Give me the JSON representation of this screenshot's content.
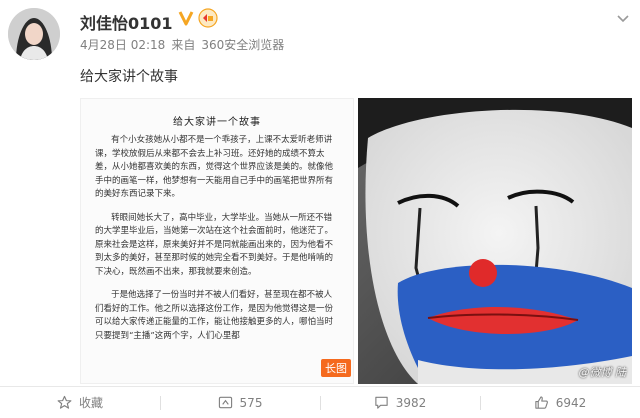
{
  "post": {
    "username": "刘佳怡0101",
    "date": "4月28日 02:18",
    "source_prefix": "来自",
    "source_app": "360安全浏览器",
    "text": "给大家讲个故事"
  },
  "document": {
    "title": "给大家讲一个故事",
    "paragraphs": [
      "有个小女孩她从小都不是一个乖孩子，上课不太爱听老师讲课，学校放假后从来都不会去上补习班。还好她的成绩不算太差，从小她都喜欢美的东西，觉得这个世界应该是美的。就像他手中的画笔一样，他梦想有一天能用自己手中的画笔把世界所有的美好东西记录下来。",
      "转眼间她长大了，高中毕业，大学毕业。当她从一所还不错的大学里毕业后，当她第一次站在这个社会面前时，他迷茫了。原来社会是这样，原来美好并不是同就能画出来的，因为他看不到太多的美好，甚至那时候的她完全看不到美好。于是他啃啃的下决心，既然画不出来，那我就要来创造。",
      "于是他选择了一份当时并不被人们看好，甚至现在都不被人们看好的工作。他之所以选择这份工作，是因为他觉得这是一份可以给大家传递正能量的工作，能让他接触更多的人，哪怕当时只要提到“主播”这两个字，人们心里都"
    ],
    "long_image_badge": "长图"
  },
  "photo": {
    "watermark": "@微博 陆"
  },
  "actions": {
    "favorite_label": "收藏",
    "repost_count": "575",
    "comment_count": "3982",
    "like_count": "6942"
  },
  "colors": {
    "vip_orange": "#f5a623",
    "badge_orange": "#f56a1e",
    "meta_gray": "#808080"
  },
  "icons": [
    "avatar",
    "verified-v-icon",
    "medal-icon",
    "chevron-down-icon",
    "star-icon",
    "repost-icon",
    "comment-icon",
    "like-icon"
  ]
}
